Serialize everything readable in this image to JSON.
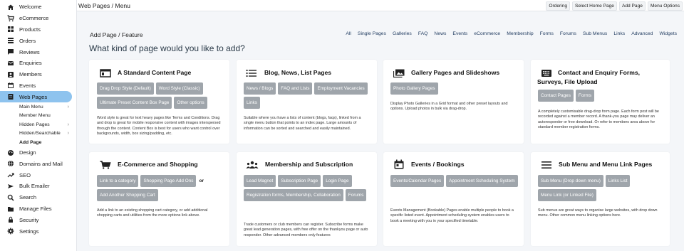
{
  "sidebar": {
    "items": [
      {
        "label": "Welcome",
        "icon": "home-icon"
      },
      {
        "label": "eCommerce",
        "icon": "cart-icon"
      },
      {
        "label": "Products",
        "icon": "grid-icon"
      },
      {
        "label": "Orders",
        "icon": "list-icon"
      },
      {
        "label": "Reviews",
        "icon": "chat-icon"
      },
      {
        "label": "Enquiries",
        "icon": "mail-icon"
      },
      {
        "label": "Members",
        "icon": "people-icon"
      },
      {
        "label": "Events",
        "icon": "calendar-icon"
      },
      {
        "label": "Web Pages",
        "icon": "pages-icon"
      }
    ],
    "sub": [
      "Main Menu",
      "Member Menu",
      "Hidden Pages",
      "Hidden/Searchable",
      "Add Page"
    ],
    "items2": [
      {
        "label": "Design",
        "icon": "palette-icon"
      },
      {
        "label": "Domains and Mail",
        "icon": "globe-icon"
      },
      {
        "label": "SEO",
        "icon": "trend-icon"
      },
      {
        "label": "Bulk Emailer",
        "icon": "send-icon"
      },
      {
        "label": "Search",
        "icon": "search-icon"
      },
      {
        "label": "Manage Files",
        "icon": "folder-icon"
      },
      {
        "label": "Security",
        "icon": "lock-icon"
      },
      {
        "label": "Settings",
        "icon": "gear-icon"
      }
    ]
  },
  "topbar": {
    "title": "Web Pages / Menu",
    "buttons": [
      "Ordering",
      "Select Home Page",
      "Add Page",
      "Menu Options"
    ]
  },
  "main": {
    "heading": "Add Page / Feature",
    "question": "What kind of page would you like to add?",
    "filters": [
      "All",
      "Single Pages",
      "Galleries",
      "FAQ",
      "News",
      "Events",
      "eCommerce",
      "Membership",
      "Forms",
      "Forums",
      "Sub Menus",
      "Links",
      "Advanced",
      "Widgets"
    ]
  },
  "cards": [
    {
      "title": "A Standard Content Page",
      "buttons": [
        "Drag Drop Style (Default)",
        "Word Style (Classic)",
        "Ultimate Preset Content Box Page",
        "Other options"
      ],
      "desc": "Word style is great for text heavy pages like Terms and Conditions. Drag and drop is great for mobile responsive content with images interspersed through the content. Content Box is best for users who want control over backgrounds, width, box sizing/padding, etc."
    },
    {
      "title": "Blog, News, List Pages",
      "buttons": [
        "News / Blogs",
        "FAQ and Lists",
        "Employment Vacancies",
        "Links"
      ],
      "desc": "Suitable where you have a lists of content (blogs, faqs), linked from a single menu button that points to an index page. Large amounts of information can be sorted and searched and easily maintained."
    },
    {
      "title": "Gallery Pages and Slideshows",
      "buttons": [
        "Photo Gallery Pages"
      ],
      "desc": "Display Photo Galleries in a Grid format and other preset layouts and options. Upload photos in bulk via drag-drop."
    },
    {
      "title": "Contact and Enquiry Forms, Surveys, File Upload",
      "buttons": [
        "Contact Pages",
        "Forms"
      ],
      "desc": "A completely customisable drag-drop form page. Each form post will be recorded against a member record. A thank-you page may deliver an autoresponder or free download. Or refer to members area above for standard member registration forms."
    },
    {
      "title": "E-Commerce and Shopping",
      "buttons": [
        "Link to a category",
        "Shopping Page Add Ons"
      ],
      "or": "or",
      "buttons2": [
        "Add Another Shopping Cart"
      ],
      "desc": "Add a link to an existing shopping cart category, or add additional shopping carts and utilities from the more options link above."
    },
    {
      "title": "Membership and Subscription",
      "buttons": [
        "Lead Magnet",
        "Subscription Page",
        "Login Page",
        "Registration forms, Membership, Collaboration",
        "Forums"
      ],
      "desc": "Trade customers or club members can register. Subscribe forms make great lead generation pages, with free offer on the thankyou page or auto responder. Other advanced members only features"
    },
    {
      "title": "Events / Bookings",
      "buttons": [
        "Events/Calendar Pages",
        "Appointment Scheduling System"
      ],
      "desc": "Events Management (Bookable) Pages enable multiple people to book a specific listed event. Appointment scheduling system enables users to book a meeting with you in your specified timetable."
    },
    {
      "title": "Sub Menu and Menu Link Pages",
      "buttons": [
        "Sub Menu (Drop down menu)",
        "Links List",
        "Menu Link (or Linked File)"
      ],
      "desc": "Sub menus are great ways to organise large websites, with drop down menu. Other common menu linking options here."
    }
  ]
}
